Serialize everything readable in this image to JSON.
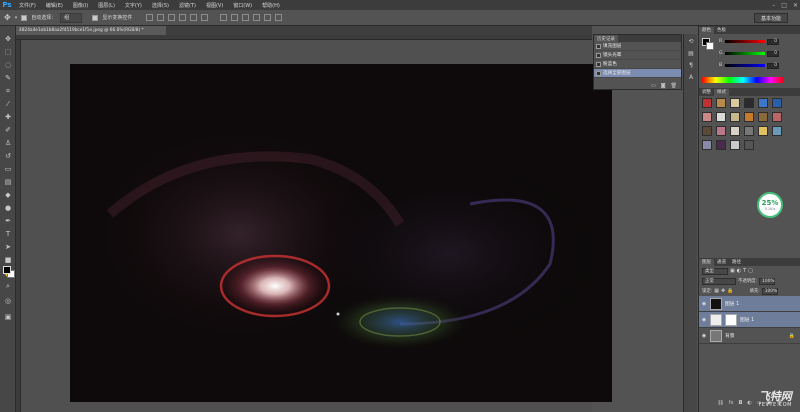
{
  "app": {
    "logo": "Ps"
  },
  "menu": [
    "文件(F)",
    "编辑(E)",
    "图像(I)",
    "图层(L)",
    "文字(Y)",
    "选择(S)",
    "滤镜(T)",
    "视图(V)",
    "窗口(W)",
    "帮助(H)"
  ],
  "options": {
    "auto_select_label": "自动选择：",
    "auto_select_value": "组",
    "show_transform_label": "显示变换控件",
    "workspace": "基本功能"
  },
  "document": {
    "tab_title": "4824a4e1eb1b8aa2f4519bce1f1e.jpeg @ 66.6%(RGB/8) *"
  },
  "history": {
    "tab_label": "历史记录",
    "items": [
      "填充图层",
      "镜头光晕",
      "粉蓝色",
      "选择全部图层"
    ]
  },
  "color_panel": {
    "tabs": [
      "颜色",
      "色板"
    ],
    "sliders": [
      {
        "label": "R",
        "value": "0",
        "color": "#d33"
      },
      {
        "label": "G",
        "value": "0",
        "color": "#3c3"
      },
      {
        "label": "B",
        "value": "0",
        "color": "#36f"
      }
    ]
  },
  "styles_panel": {
    "tabs": [
      "调整",
      "样式"
    ],
    "swatches": [
      "#b33",
      "#b98a4a",
      "#d9c9a0",
      "#2b2b2b",
      "#3d77c9",
      "#2a5ea8",
      "#c88",
      "#d9d9d9",
      "#c9b889",
      "#c77a2a",
      "#8a6a3a",
      "#b66",
      "#5a4a3a",
      "#b78",
      "#d8d1c8",
      "#777",
      "#e0c060",
      "#6a9ab8",
      "#8a8aa8",
      "#4a2a4a",
      "#c9c9c9",
      "#555"
    ]
  },
  "progress": {
    "value": "25%",
    "sub": "0.1K/s"
  },
  "layers": {
    "tabs": [
      "图层",
      "通道",
      "路径"
    ],
    "kind_filter": "类型",
    "blend_mode": "正常",
    "opacity_label": "不透明度:",
    "opacity_value": "100%",
    "lock_label": "锁定:",
    "fill_label": "填充:",
    "fill_value": "100%",
    "items": [
      {
        "name": "图层 1",
        "selected": true
      },
      {
        "name": "图层 1",
        "selected": true
      },
      {
        "name": "背景",
        "selected": false
      }
    ]
  },
  "watermark": {
    "logo": "飞特网",
    "url": "FEVTE.COM"
  }
}
